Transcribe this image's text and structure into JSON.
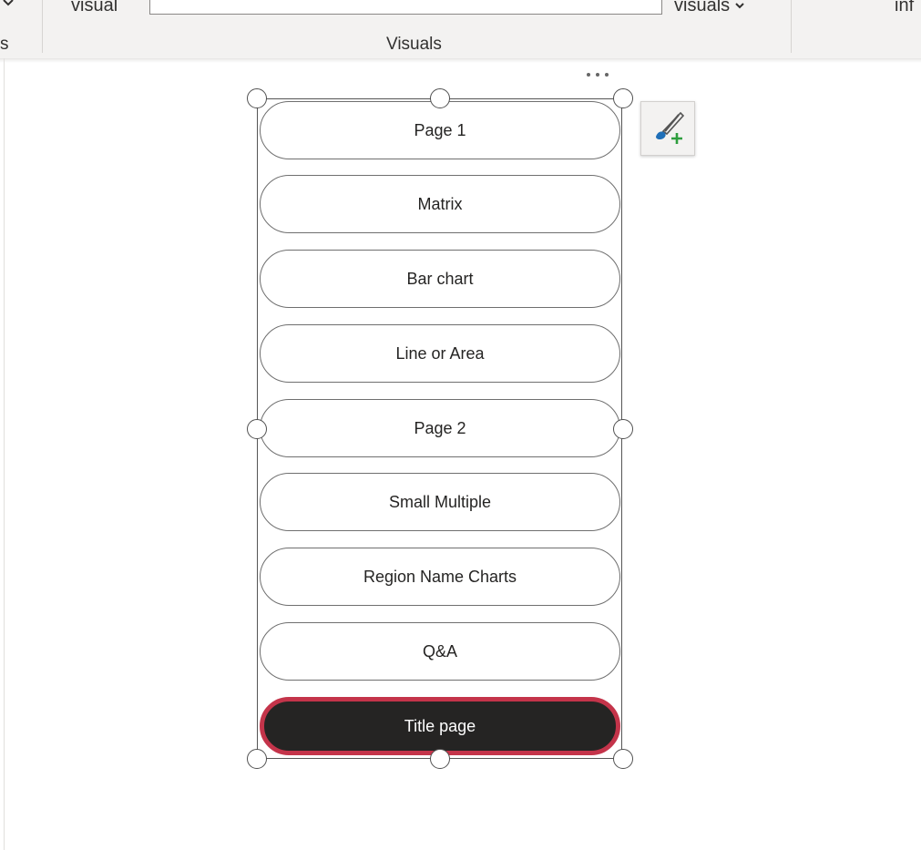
{
  "ribbon": {
    "left_label": "visual",
    "right_dropdown_label": "visuals",
    "far_right_label": "inf",
    "far_left_partial_label": "s",
    "group_label": "Visuals"
  },
  "visual": {
    "more_options_icon": "ellipsis-icon",
    "format_icon": "paintbrush-add-icon",
    "buttons": [
      {
        "label": "Page 1",
        "active": false
      },
      {
        "label": "Matrix",
        "active": false
      },
      {
        "label": "Bar chart",
        "active": false
      },
      {
        "label": "Line or Area",
        "active": false
      },
      {
        "label": "Page 2",
        "active": false
      },
      {
        "label": "Small Multiple",
        "active": false
      },
      {
        "label": "Region Name Charts",
        "active": false
      },
      {
        "label": "Q&A",
        "active": false
      },
      {
        "label": "Title page",
        "active": true
      }
    ]
  },
  "colors": {
    "active_fill": "#252423",
    "active_border": "#c4344a",
    "brush_blue": "#1f6fb8",
    "plus_green": "#2e9e3e"
  }
}
